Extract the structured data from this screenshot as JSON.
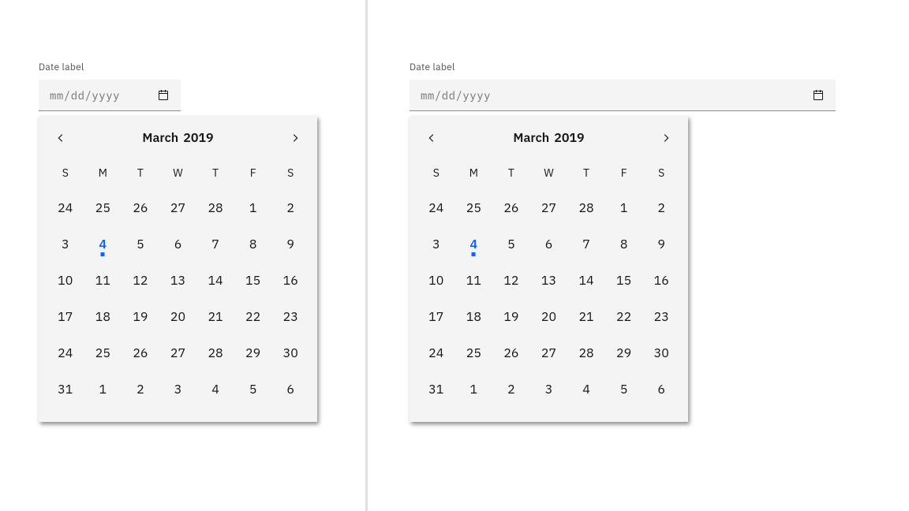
{
  "label": "Date label",
  "placeholder": "mm/dd/yyyy",
  "icons": {
    "calendar": "calendar-icon"
  },
  "calendar": {
    "month": "March",
    "year": "2019",
    "weekdays": [
      "S",
      "M",
      "T",
      "W",
      "T",
      "F",
      "S"
    ],
    "today": 4,
    "days": [
      [
        24,
        25,
        26,
        27,
        28,
        1,
        2
      ],
      [
        3,
        4,
        5,
        6,
        7,
        8,
        9
      ],
      [
        10,
        11,
        12,
        13,
        14,
        15,
        16
      ],
      [
        17,
        18,
        19,
        20,
        21,
        22,
        23
      ],
      [
        24,
        25,
        26,
        27,
        28,
        29,
        30
      ],
      [
        31,
        1,
        2,
        3,
        4,
        5,
        6
      ]
    ]
  },
  "colors": {
    "accent": "#0f62fe",
    "background": "#f4f4f4"
  }
}
